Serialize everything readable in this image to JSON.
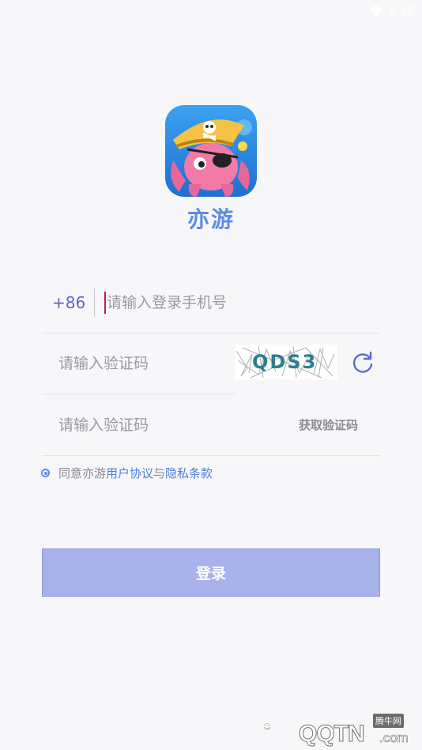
{
  "status_bar": {
    "time": "8:48"
  },
  "app": {
    "name": "亦游"
  },
  "phone": {
    "prefix": "+86",
    "placeholder": "请输入登录手机号"
  },
  "captcha": {
    "placeholder": "请输入验证码",
    "image_text": "QDS3"
  },
  "sms": {
    "placeholder": "请输入验证码",
    "get_code_label": "获取验证码"
  },
  "agreement": {
    "prefix": "同意亦游",
    "user_agreement": "用户协议",
    "and": "与",
    "privacy": "隐私条款"
  },
  "login": {
    "label": "登录"
  },
  "watermark": {
    "site": "腾牛网",
    "brand": "QQTN",
    "suffix": ".com"
  },
  "colors": {
    "accent": "#5a8de6",
    "button": "#a7b1ea",
    "prefix": "#6066b8"
  }
}
